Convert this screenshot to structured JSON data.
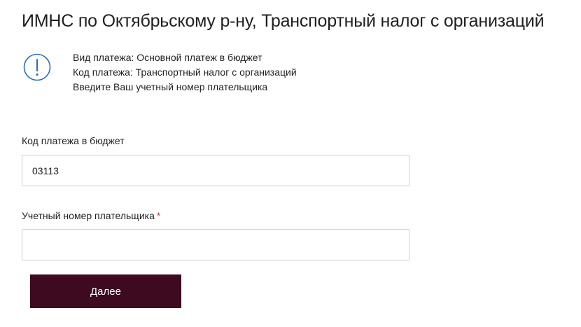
{
  "header": {
    "title": "ИМНС по Октябрьскому р-ну, Транспортный налог с организаций"
  },
  "info": {
    "icon": "exclamation-circle-icon",
    "lines": [
      "Вид платежа: Основной платеж в бюджет",
      "Код платежа: Транспортный налог с организаций",
      "Введите Ваш учетный номер плательщика"
    ]
  },
  "form": {
    "payment_code": {
      "label": "Код платежа в бюджет",
      "value": "03113"
    },
    "taxpayer_number": {
      "label": "Учетный номер плательщика",
      "required_mark": "*",
      "value": ""
    },
    "submit_label": "Далее"
  },
  "colors": {
    "accent": "#3d0a1f",
    "icon": "#2a6fb5",
    "required": "#c0392b"
  }
}
